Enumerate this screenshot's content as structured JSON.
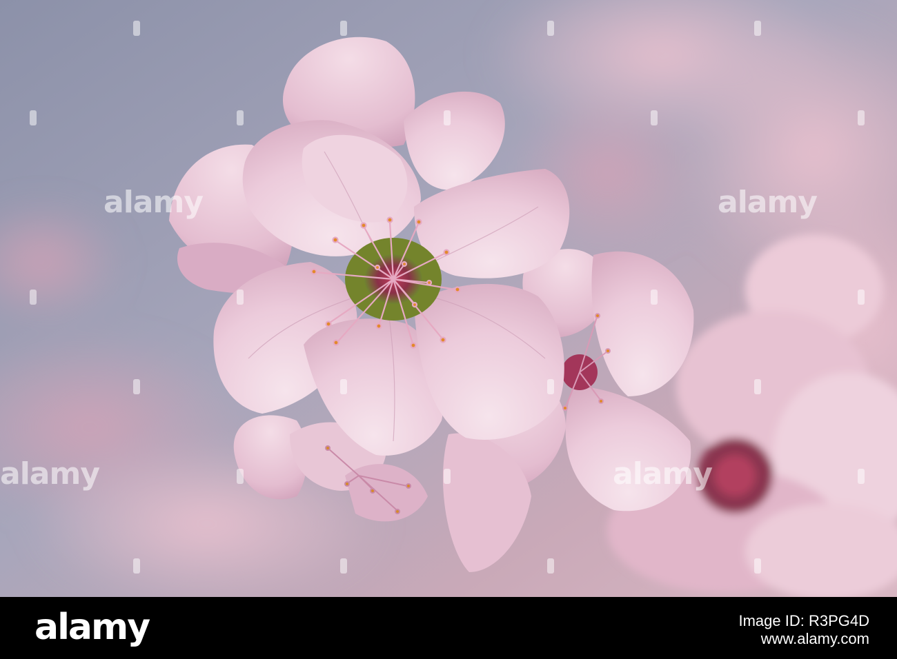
{
  "photo": {
    "subject": "pink-almond-blossom",
    "colors": {
      "background_blue": "#8f93ab",
      "petal_light": "#f1d6e2",
      "petal_mid": "#e2b8cc",
      "petal_shadow": "#c99ab3",
      "center_green": "#7b8a2e",
      "center_red": "#b2345a",
      "anther_orange": "#e88a2a"
    }
  },
  "watermark": {
    "text": "alamy"
  },
  "footer": {
    "logo": "alamy",
    "image_id": "Image ID: R3PG4D",
    "url": "www.alamy.com"
  }
}
